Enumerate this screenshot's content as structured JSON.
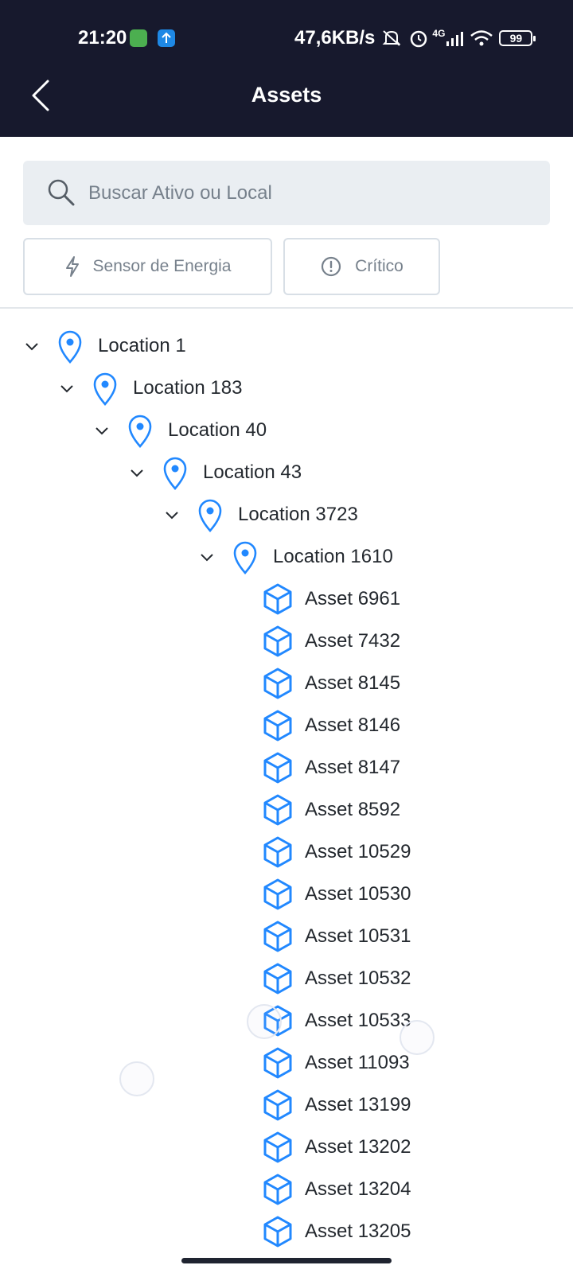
{
  "status_bar": {
    "time": "21:20",
    "network_speed": "47,6KB/s",
    "signal_label": "4G",
    "battery": "99"
  },
  "header": {
    "title": "Assets",
    "back_icon": "chevron-left-icon"
  },
  "search": {
    "placeholder": "Buscar Ativo ou Local",
    "value": ""
  },
  "filters": {
    "energy_label": "Sensor de Energia",
    "critical_label": "Crítico"
  },
  "tree": {
    "locations": [
      {
        "label": "Location 1"
      },
      {
        "label": "Location 183"
      },
      {
        "label": "Location 40"
      },
      {
        "label": "Location 43"
      },
      {
        "label": "Location 3723"
      },
      {
        "label": "Location 1610"
      }
    ],
    "assets": [
      {
        "label": "Asset 6961"
      },
      {
        "label": "Asset 7432"
      },
      {
        "label": "Asset 8145"
      },
      {
        "label": "Asset 8146"
      },
      {
        "label": "Asset 8147"
      },
      {
        "label": "Asset 8592"
      },
      {
        "label": "Asset 10529"
      },
      {
        "label": "Asset 10530"
      },
      {
        "label": "Asset 10531"
      },
      {
        "label": "Asset 10532"
      },
      {
        "label": "Asset 10533"
      },
      {
        "label": "Asset 11093"
      },
      {
        "label": "Asset 13199"
      },
      {
        "label": "Asset 13202"
      },
      {
        "label": "Asset 13204"
      },
      {
        "label": "Asset 13205"
      }
    ]
  },
  "colors": {
    "header_bg": "#17192d",
    "accent_blue": "#2188ff",
    "search_bg": "#eaeef2"
  }
}
